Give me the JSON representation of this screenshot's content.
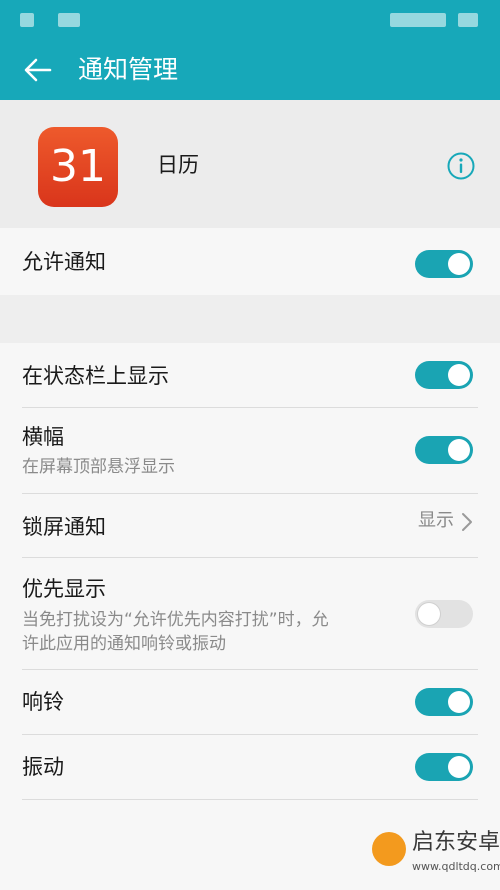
{
  "header": {
    "title": "通知管理",
    "back_icon": "arrow-left-icon"
  },
  "app": {
    "icon_text": "31",
    "name": "日历",
    "info_icon": "info-circle-icon"
  },
  "colors": {
    "accent": "#17a8b9",
    "toggle_on": "#1aa4b3",
    "app_icon": "#e2421f"
  },
  "settings": {
    "allow": {
      "label": "允许通知",
      "on": true
    },
    "statusbar": {
      "label": "在状态栏上显示",
      "on": true
    },
    "banner": {
      "label": "横幅",
      "sub": "在屏幕顶部悬浮显示",
      "on": true
    },
    "lockscreen": {
      "label": "锁屏通知",
      "value": "显示"
    },
    "priority": {
      "label": "优先显示",
      "sub_line1": "当免打扰设为“允许优先内容打扰”时，允",
      "sub_line2": "许此应用的通知响铃或振动",
      "on": false
    },
    "ring": {
      "label": "响铃",
      "on": true
    },
    "vibrate": {
      "label": "振动",
      "on": true
    }
  },
  "watermark": {
    "text": "启东安卓网",
    "url": "www.qdltdq.com"
  }
}
